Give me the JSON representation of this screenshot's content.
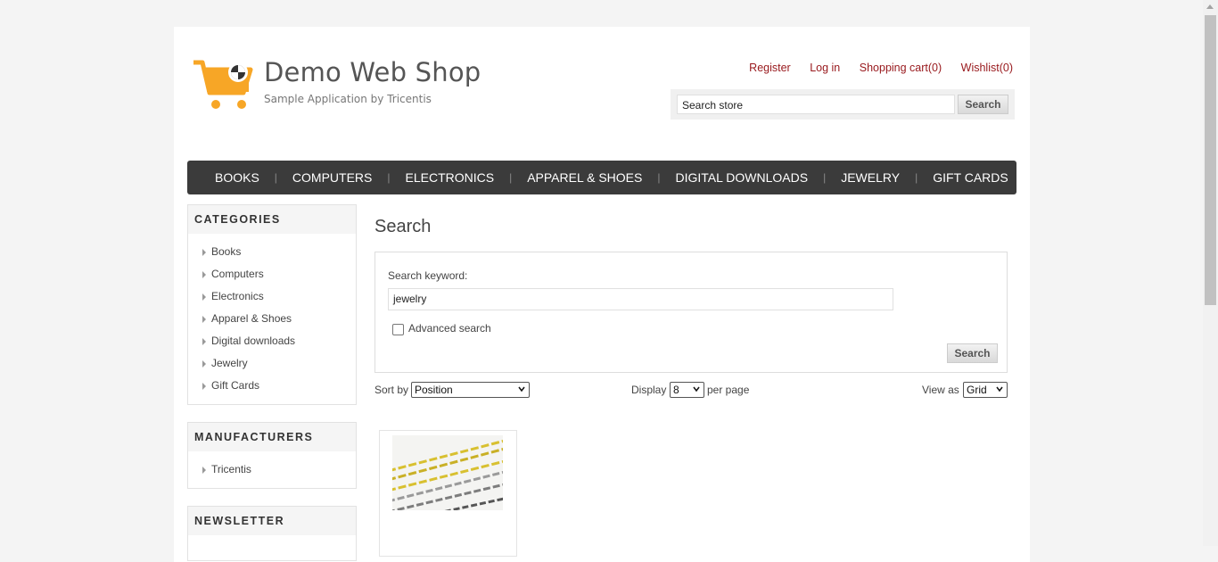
{
  "header": {
    "title": "Demo Web Shop",
    "subtitle": "Sample Application by Tricentis",
    "links": [
      "Register",
      "Log in",
      "Shopping cart(0)",
      "Wishlist(0)"
    ],
    "search_placeholder": "Search store",
    "search_button": "Search"
  },
  "menu": [
    "BOOKS",
    "COMPUTERS",
    "ELECTRONICS",
    "APPAREL & SHOES",
    "DIGITAL DOWNLOADS",
    "JEWELRY",
    "GIFT CARDS"
  ],
  "sidebar": {
    "categories_title": "CATEGORIES",
    "categories": [
      "Books",
      "Computers",
      "Electronics",
      "Apparel & Shoes",
      "Digital downloads",
      "Jewelry",
      "Gift Cards"
    ],
    "manufacturers_title": "MANUFACTURERS",
    "manufacturers": [
      "Tricentis"
    ],
    "newsletter_title": "NEWSLETTER"
  },
  "main": {
    "title": "Search",
    "keyword_label": "Search keyword:",
    "keyword_value": "jewelry",
    "advanced_label": "Advanced search",
    "advanced_checked": false,
    "search_button": "Search",
    "sort_label": "Sort by",
    "sort_value": "Position",
    "display_label": "Display",
    "display_value": "8",
    "per_page_label": "per page",
    "view_label": "View as",
    "view_value": "Grid"
  },
  "colors": {
    "link": "#98181c",
    "menu_bg": "#3b3b3b",
    "logo": "#f7a626"
  }
}
